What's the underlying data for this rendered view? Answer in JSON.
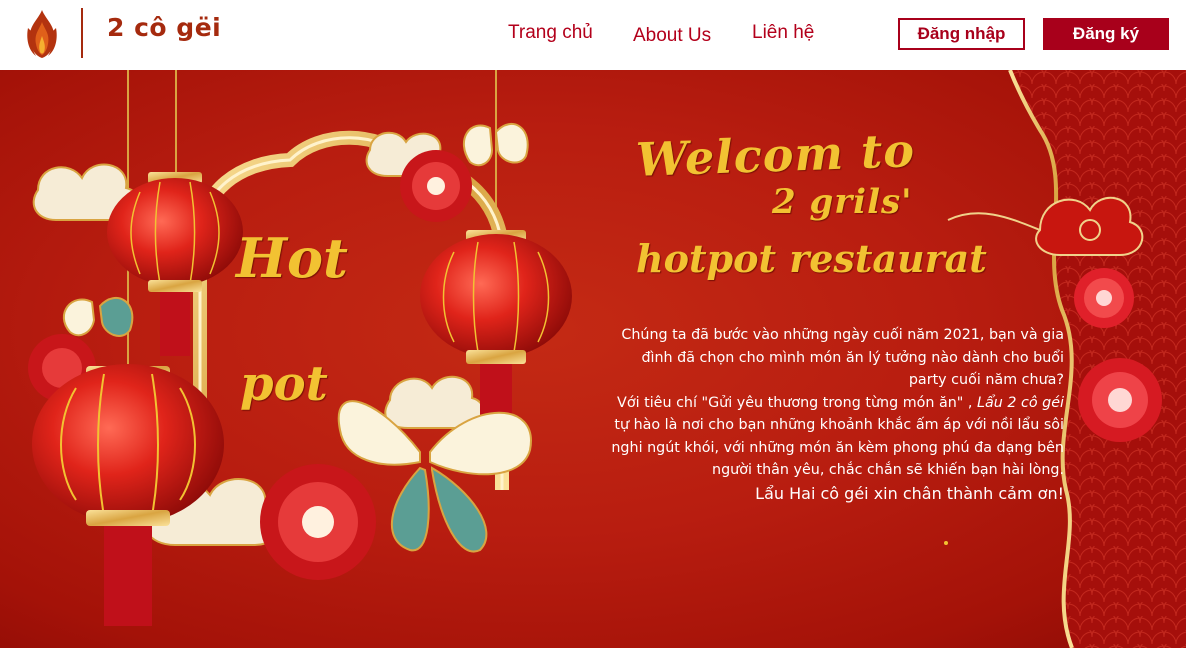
{
  "header": {
    "logo_text": "2 cô gëi",
    "nav": {
      "home": "Trang chủ",
      "about": "About Us",
      "contact": "Liên hệ"
    },
    "login_label": "Đăng nhập",
    "register_label": "Đăng ký"
  },
  "banner": {
    "welcome_line1": "Welcom to",
    "welcome_line2": "2 grils'",
    "welcome_line3": "hotpot restaurat",
    "hot_line1": "Hot",
    "hot_line2": "pot",
    "intro_part1": "Chúng ta đã bước vào những ngày cuối năm 2021, bạn và gia đình đã chọn cho mình món ăn lý tưởng nào dành cho buổi party cuối năm chưa?",
    "intro_part2_lead": "Với tiêu chí \"Gửi yêu thương trong từng món ăn\" , ",
    "intro_part2_brand": "Lẩu 2 cô géi",
    "intro_part2_rest": " tự hào là nơi cho bạn những khoảnh khắc ấm áp với nồi lẩu sôi nghi ngút khói, với những món ăn kèm phong phú đa dạng  bên người thân yêu, chắc chắn sẽ khiến bạn hài lòng.",
    "thanks": "Lẩu Hai cô géi xin chân thành cảm ơn!"
  },
  "colors": {
    "brand_red": "#a8001b",
    "logo_brown": "#a52a0e",
    "gold": "#f2c232",
    "banner_red": "#b81d10"
  },
  "icons": [
    "flame-logo-icon",
    "lantern-icon",
    "butterfly-icon",
    "flower-icon",
    "cloud-icon"
  ]
}
